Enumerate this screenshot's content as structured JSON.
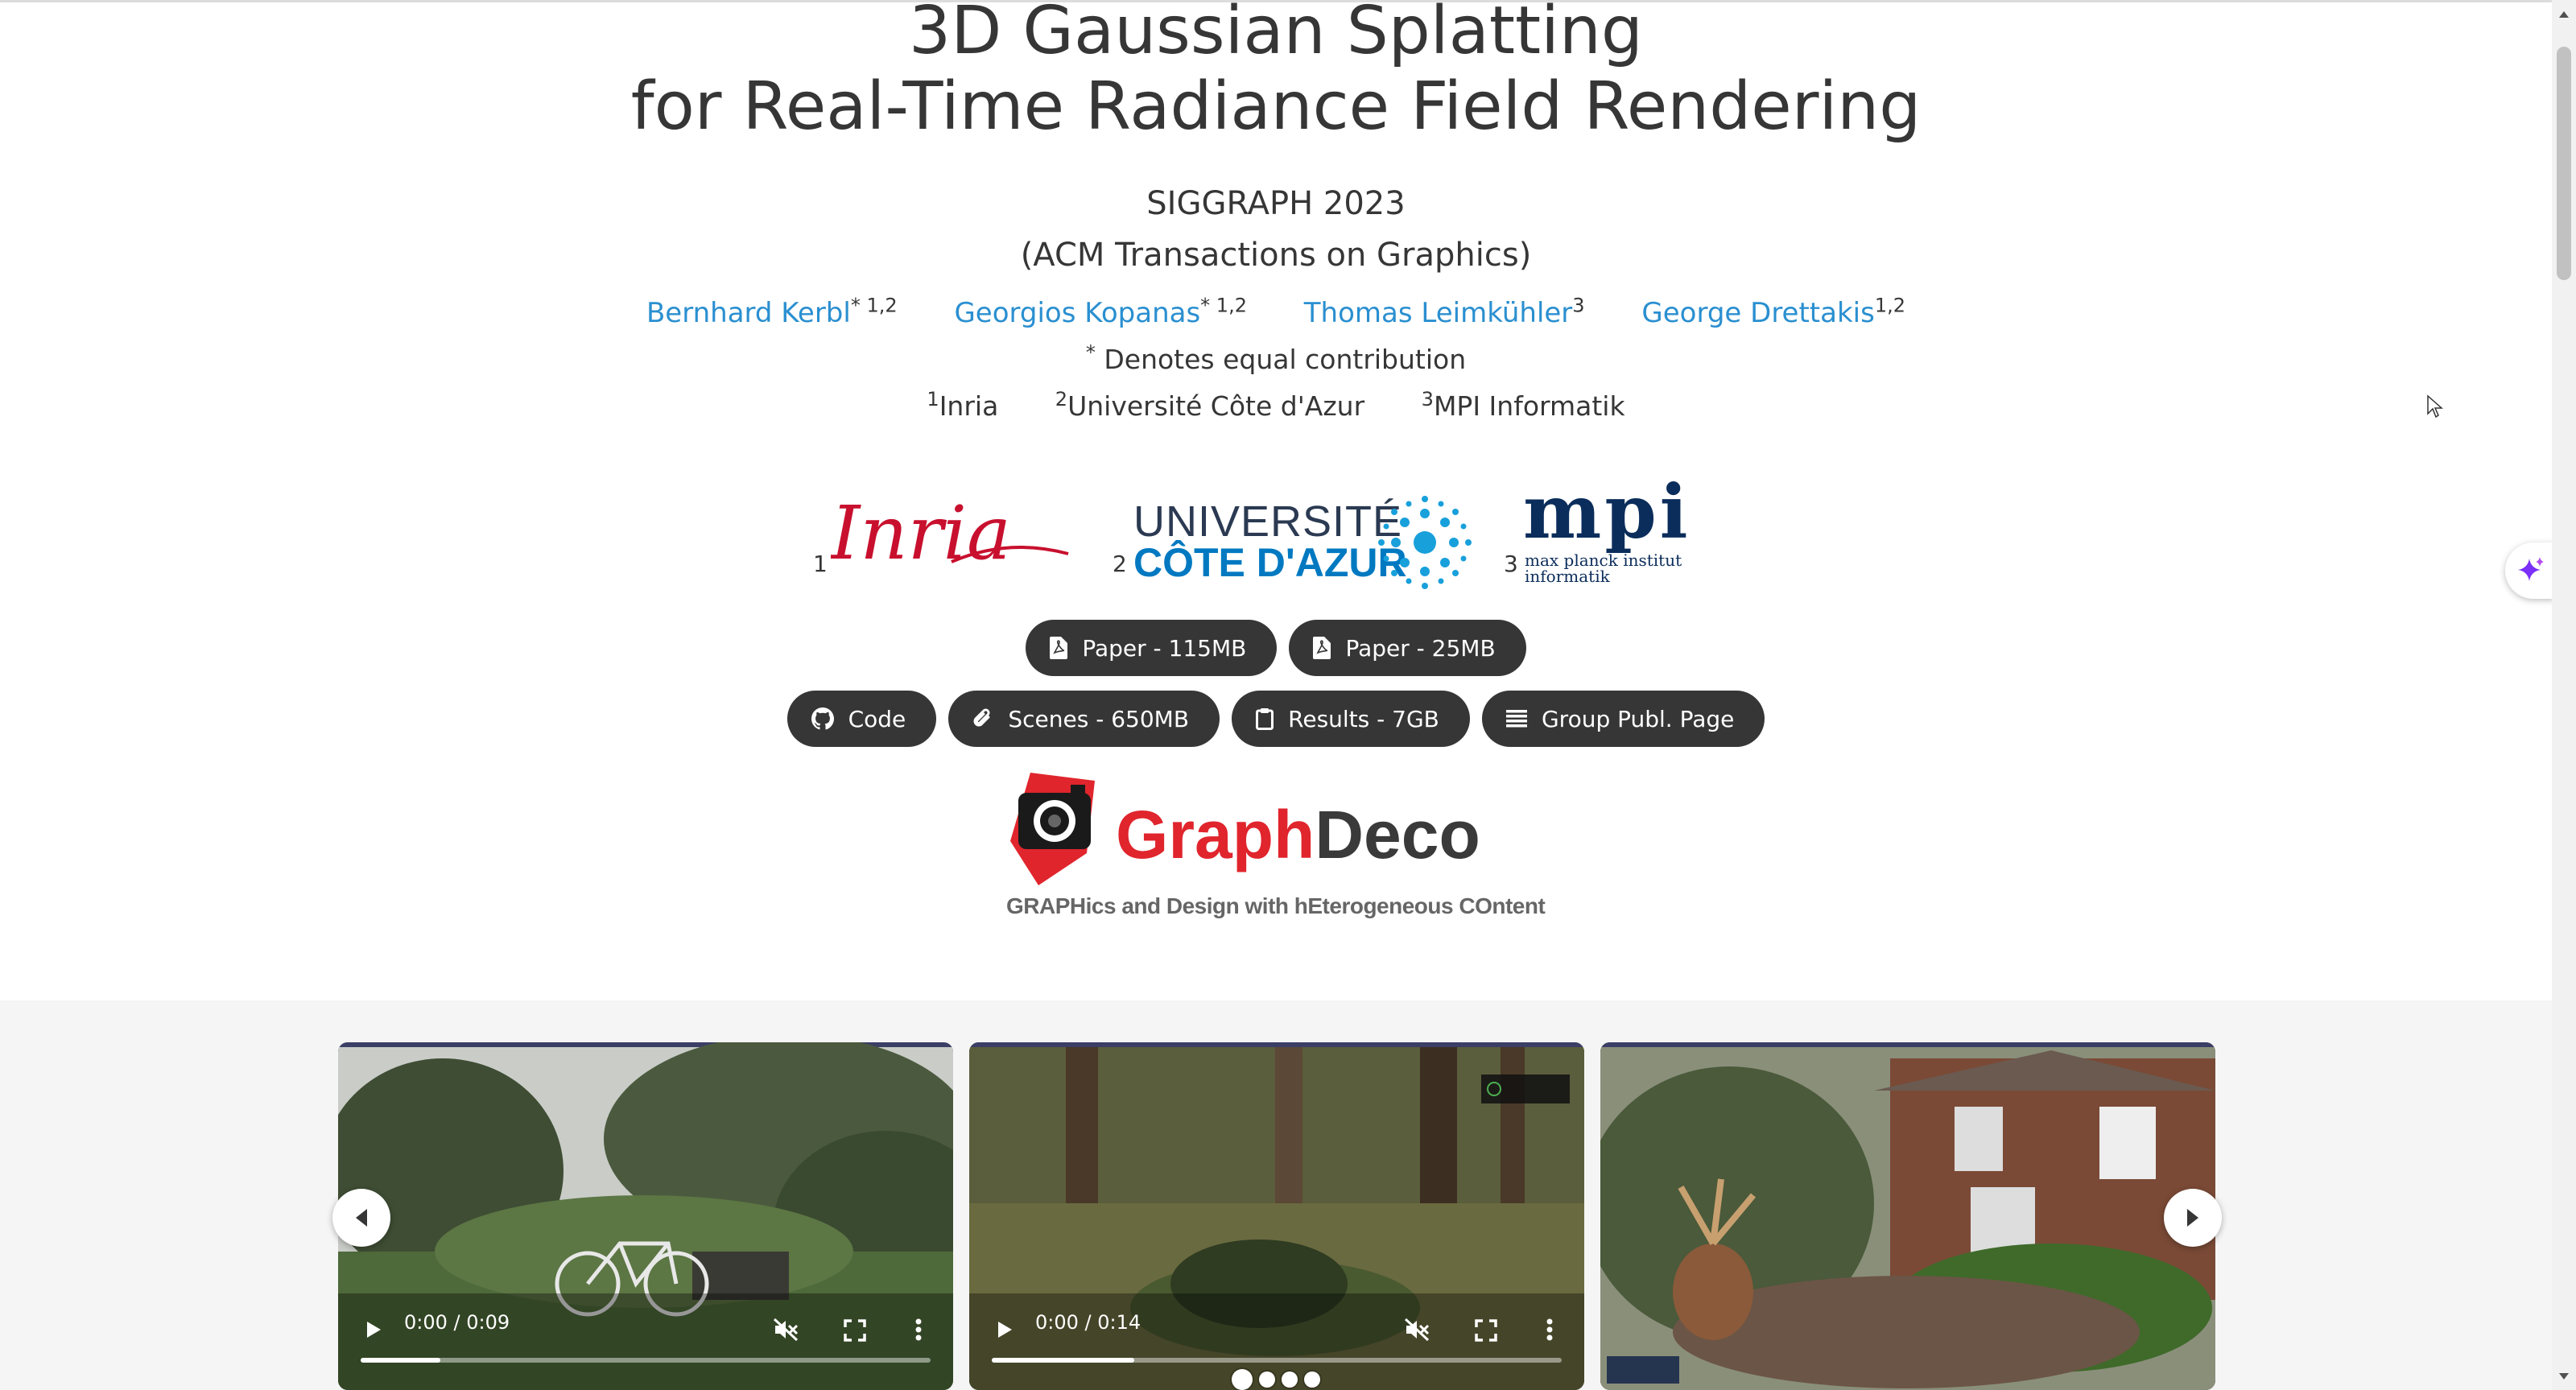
{
  "paper": {
    "title_line1": "3D Gaussian Splatting",
    "title_line2": "for Real-Time Radiance Field Rendering",
    "venue_line1": "SIGGRAPH 2023",
    "venue_line2": "(ACM Transactions on Graphics)"
  },
  "authors": [
    {
      "name": "Bernhard Kerbl",
      "sup": "* 1,2"
    },
    {
      "name": "Georgios Kopanas",
      "sup": "* 1,2"
    },
    {
      "name": "Thomas Leimkühler",
      "sup": "3"
    },
    {
      "name": "George Drettakis",
      "sup": "1,2"
    }
  ],
  "note": {
    "mark": "*",
    "text": " Denotes equal contribution"
  },
  "affiliations": [
    {
      "num": "1",
      "name": "Inria"
    },
    {
      "num": "2",
      "name": "Université Côte d'Azur"
    },
    {
      "num": "3",
      "name": "MPI Informatik"
    }
  ],
  "logos": {
    "inria": {
      "num": "1",
      "text": "Inria"
    },
    "uca": {
      "num": "2",
      "line1": "UNIVERSITÉ",
      "line2": "CÔTE D'AZUR"
    },
    "mpi": {
      "num": "3",
      "mark": "mpi",
      "line1": "max planck institut",
      "line2": "informatik"
    },
    "graphdeco": {
      "part1": "Graph",
      "part2": "Deco",
      "tagline": "GRAPHics and Design with hEterogeneous COntent"
    }
  },
  "buttons": {
    "paper_115": "Paper - 115MB",
    "paper_25": "Paper - 25MB",
    "code": "Code",
    "scenes": "Scenes - 650MB",
    "results": "Results - 7GB",
    "group": "Group Publ. Page"
  },
  "videos": [
    {
      "time": "0:00 / 0:09"
    },
    {
      "time": "0:00 / 0:14"
    },
    {
      "time": ""
    }
  ],
  "colors": {
    "link": "#2a8fd0",
    "button_bg": "#363636",
    "inria_red": "#c8102e",
    "uca_blue": "#0079c1",
    "mpi_navy": "#0b2d5b",
    "graphdeco_red": "#e0252d"
  }
}
